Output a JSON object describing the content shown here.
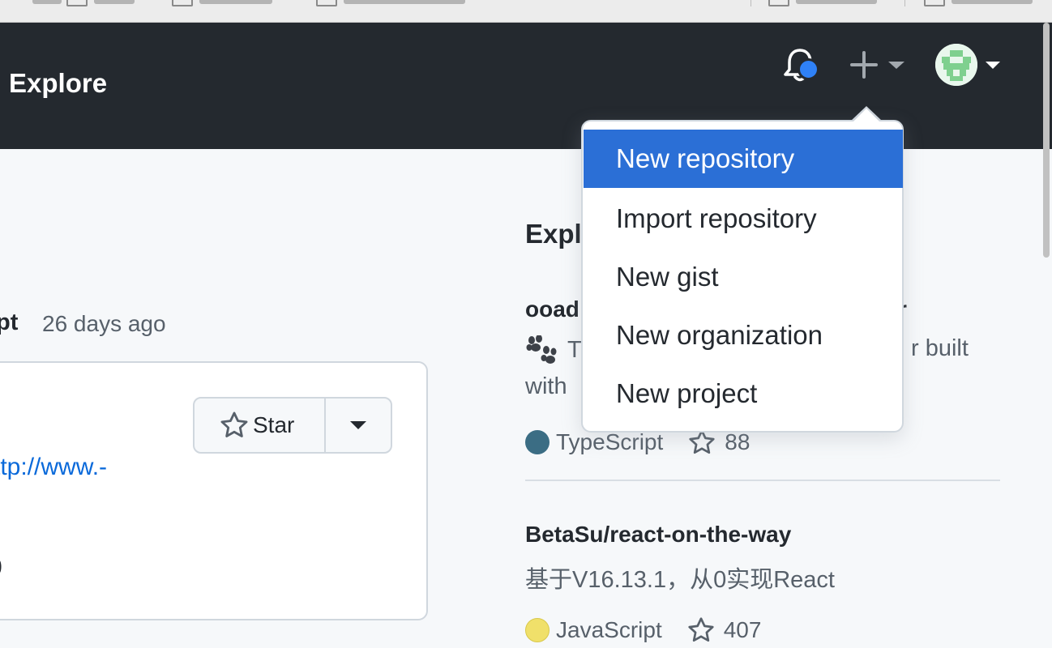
{
  "header": {
    "explore": "Explore",
    "avatar_alt": "avatar"
  },
  "create_menu": {
    "items": [
      {
        "label": "New repository",
        "active": true
      },
      {
        "label": "Import repository",
        "active": false
      },
      {
        "label": "New gist",
        "active": false
      },
      {
        "label": "New organization",
        "active": false
      },
      {
        "label": "New project",
        "active": false
      }
    ]
  },
  "feed": {
    "title_fragment": "pt",
    "time": "26 days ago",
    "star_label": "Star",
    "link_fragment": "ttp://www.-",
    "digit_fragment": "0"
  },
  "explore_panel": {
    "heading_fragment": "Expl",
    "repos": [
      {
        "name_fragment": "ooad",
        "name_tail": "r",
        "desc_prefix": "T",
        "desc_tail": "r built",
        "desc_line2": "with",
        "language": "TypeScript",
        "language_color": "#3178c6",
        "stars": "88"
      },
      {
        "name": "BetaSu/react-on-the-way",
        "description": "基于V16.13.1，从0实现React",
        "language": "JavaScript",
        "language_color": "#f1e05a",
        "stars": "407"
      }
    ]
  },
  "icons": {
    "bell": "bell-icon",
    "plus": "plus-icon",
    "star": "star-icon",
    "paw": "paw-prints-icon"
  }
}
